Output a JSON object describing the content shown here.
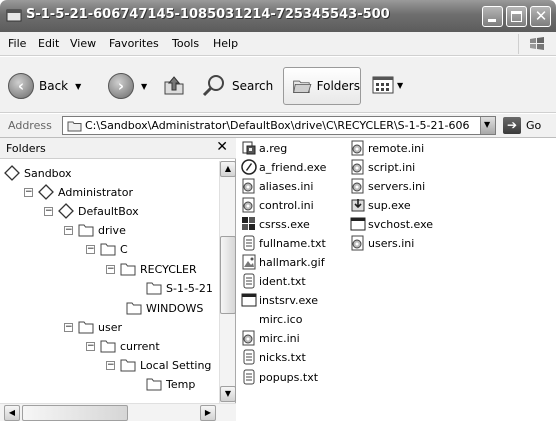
{
  "window": {
    "title": "S-1-5-21-606747145-1085031214-725345543-500"
  },
  "menu": [
    "File",
    "Edit",
    "View",
    "Favorites",
    "Tools",
    "Help"
  ],
  "toolbar": {
    "back_label": "Back",
    "search_label": "Search",
    "folders_label": "Folders"
  },
  "address": {
    "label": "Address",
    "path": "C:\\Sandbox\\Administrator\\DefaultBox\\drive\\C\\RECYCLER\\S-1-5-21-606",
    "go_label": "Go"
  },
  "folders_pane": {
    "title": "Folders",
    "tree": [
      {
        "label": "Sandbox",
        "icon": "sandbox-icon"
      },
      {
        "label": "Administrator",
        "icon": "sandbox-icon"
      },
      {
        "label": "DefaultBox",
        "icon": "sandbox-icon"
      },
      {
        "label": "drive",
        "icon": "folder-icon"
      },
      {
        "label": "C",
        "icon": "folder-icon"
      },
      {
        "label": "RECYCLER",
        "icon": "folder-icon"
      },
      {
        "label": "S-1-5-21",
        "icon": "folder-icon"
      },
      {
        "label": "WINDOWS",
        "icon": "folder-icon"
      },
      {
        "label": "user",
        "icon": "folder-icon"
      },
      {
        "label": "current",
        "icon": "folder-icon"
      },
      {
        "label": "Local Setting",
        "icon": "folder-icon"
      },
      {
        "label": "Temp",
        "icon": "folder-icon"
      }
    ]
  },
  "files_col1": [
    {
      "name": "a.reg",
      "icon": "registry-file-icon"
    },
    {
      "name": "a_friend.exe",
      "icon": "exe-icon"
    },
    {
      "name": "aliases.ini",
      "icon": "ini-icon"
    },
    {
      "name": "control.ini",
      "icon": "ini-icon"
    },
    {
      "name": "csrss.exe",
      "icon": "exe-icon"
    },
    {
      "name": "fullname.txt",
      "icon": "text-file-icon"
    },
    {
      "name": "hallmark.gif",
      "icon": "image-file-icon"
    },
    {
      "name": "ident.txt",
      "icon": "text-file-icon"
    },
    {
      "name": "instsrv.exe",
      "icon": "window-exe-icon"
    },
    {
      "name": "mirc.ico",
      "icon": "none"
    },
    {
      "name": "mirc.ini",
      "icon": "ini-icon"
    },
    {
      "name": "nicks.txt",
      "icon": "text-file-icon"
    },
    {
      "name": "popups.txt",
      "icon": "text-file-icon"
    }
  ],
  "files_col2": [
    {
      "name": "remote.ini",
      "icon": "ini-icon"
    },
    {
      "name": "script.ini",
      "icon": "ini-icon"
    },
    {
      "name": "servers.ini",
      "icon": "ini-icon"
    },
    {
      "name": "sup.exe",
      "icon": "setup-exe-icon"
    },
    {
      "name": "svchost.exe",
      "icon": "window-exe-icon"
    },
    {
      "name": "users.ini",
      "icon": "ini-icon"
    }
  ]
}
